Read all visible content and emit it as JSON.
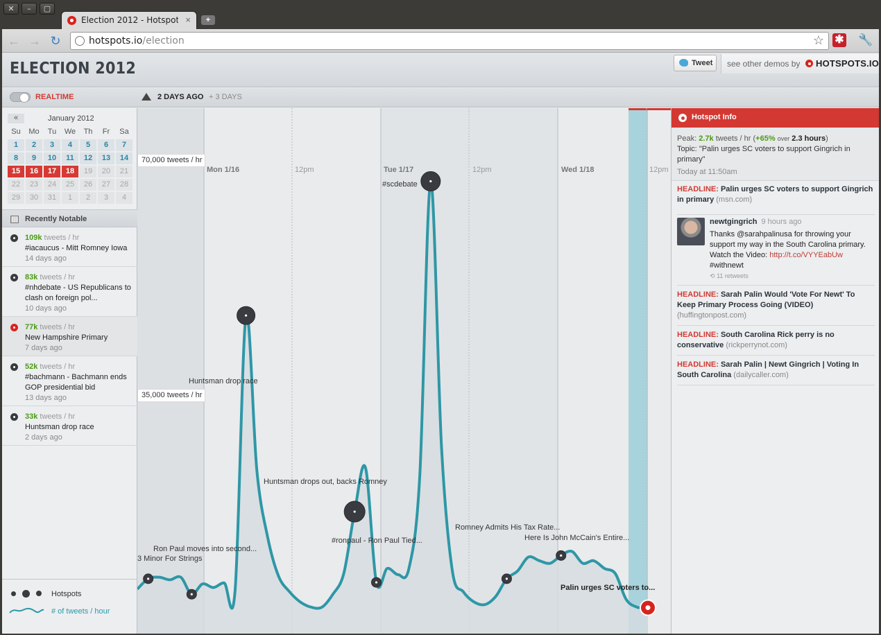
{
  "browser": {
    "tab_title": "Election 2012 - Hotspots.io",
    "tab_close": "×",
    "new_tab": "+",
    "url_host": "hotspots.io",
    "url_path": "/election",
    "star_icon": "star-icon",
    "wrench_icon": "wrench-icon",
    "extension_glyph": "✱"
  },
  "header": {
    "title": "ELECTION 2012",
    "tweet_button": "Tweet",
    "demos_text": "see other demos by",
    "brand": "HOTSPOTS.IO"
  },
  "controls": {
    "realtime_label": "REALTIME",
    "range_label": "2 DAYS AGO",
    "range_more": "+ 3 DAYS"
  },
  "calendar": {
    "prev_label": "«",
    "month": "January 2012",
    "weekdays": [
      "Su",
      "Mo",
      "Tu",
      "We",
      "Th",
      "Fr",
      "Sa"
    ],
    "weeks": [
      [
        "1",
        "2",
        "3",
        "4",
        "5",
        "6",
        "7"
      ],
      [
        "8",
        "9",
        "10",
        "11",
        "12",
        "13",
        "14"
      ],
      [
        "15",
        "16",
        "17",
        "18",
        "19",
        "20",
        "21"
      ],
      [
        "22",
        "23",
        "24",
        "25",
        "26",
        "27",
        "28"
      ],
      [
        "29",
        "30",
        "31",
        "1",
        "2",
        "3",
        "4"
      ]
    ],
    "selected_days": [
      "15",
      "16",
      "17",
      "18"
    ]
  },
  "recent": {
    "header": "Recently Notable",
    "unit": "tweets / hr",
    "items": [
      {
        "rate": "109k",
        "title": "#iacaucus - Mitt Romney Iowa",
        "ago": "14 days ago"
      },
      {
        "rate": "83k",
        "title": "#nhdebate - US Republicans to clash on foreign pol...",
        "ago": "10 days ago"
      },
      {
        "rate": "77k",
        "title": "New Hampshire Primary",
        "ago": "7 days ago"
      },
      {
        "rate": "52k",
        "title": "#bachmann - Bachmann ends GOP presidential bid",
        "ago": "13 days ago"
      },
      {
        "rate": "33k",
        "title": "Huntsman drop race",
        "ago": "2 days ago"
      }
    ]
  },
  "legend": {
    "hotspots": "Hotspots",
    "line": "# of tweets / hour"
  },
  "chart_data": {
    "type": "area",
    "x_labels": [
      "Mon 1/16",
      "12pm",
      "Tue 1/17",
      "12pm",
      "Wed 1/18",
      "12pm"
    ],
    "y_labels": [
      "70,000 tweets / hr",
      "35,000 tweets / hr"
    ],
    "ylim": [
      0,
      85000
    ],
    "series": [
      {
        "values": [
          5000,
          7000,
          7300,
          6800,
          7300,
          4000,
          6000,
          5300,
          6200,
          4800,
          58000,
          28000,
          15000,
          7500,
          4500,
          2500,
          1500,
          1500,
          4000,
          8000,
          20000,
          28500,
          6300,
          9000,
          7800,
          9000,
          27000,
          84000,
          32500,
          8500,
          4500,
          2500,
          2000,
          3600,
          7000,
          8500,
          11200,
          10500,
          10000,
          11500,
          12300,
          10000,
          10500,
          9000,
          8000,
          3000,
          1500,
          1400
        ]
      }
    ],
    "hotspots": [
      {
        "label": "3 Minor For Strings"
      },
      {
        "label": "Ron Paul moves into second..."
      },
      {
        "label": "Huntsman drop race"
      },
      {
        "label": "Huntsman drops out, backs Romney"
      },
      {
        "label": "#ronpaul - Ron Paul Tied..."
      },
      {
        "label": "#scdebate"
      },
      {
        "label": "Romney Admits His Tax Rate..."
      },
      {
        "label": "Here Is John McCain's Entire..."
      },
      {
        "label": "Palin urges SC voters to..."
      }
    ],
    "line_color": "#2e97a6",
    "fill_color": "#d6dce0",
    "highlight_color": "#a9d3dc"
  },
  "info": {
    "header": "Hotspot Info",
    "peak_label": "Peak:",
    "peak_value": "2.7k",
    "peak_unit": "tweets / hr",
    "change": "+65%",
    "over": "over",
    "duration": "2.3 hours",
    "topic_label": "Topic:",
    "topic": "\"Palin urges SC voters to support Gingrich in primary\"",
    "when": "Today at 11:50am",
    "headline_prefix": "HEADLINE:",
    "feed": [
      {
        "title": "Palin urges SC voters to support Gingrich in primary",
        "source": "(msn.com)"
      },
      {
        "title": "Sarah Palin Would 'Vote For Newt' To Keep Primary Process Going (VIDEO)",
        "source": "(huffingtonpost.com)"
      },
      {
        "title": "South Carolina Rick perry is no conservative",
        "source": "(rickperrynot.com)"
      },
      {
        "title": "Sarah Palin | Newt Gingrich | Voting In South Carolina",
        "source": "(dailycaller.com)"
      }
    ],
    "tweet": {
      "user": "newtgingrich",
      "time": "9 hours ago",
      "text": "Thanks @sarahpalinusa for throwing your support my way in the South Carolina primary. Watch the Video: ",
      "link": "http://t.co/VYYEabUw",
      "tag": "#withnewt",
      "retweets": "11 retweets"
    }
  }
}
